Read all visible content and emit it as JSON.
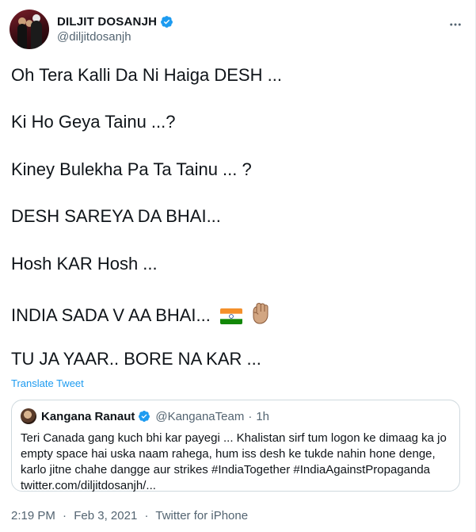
{
  "author": {
    "display_name": "DILJIT DOSANJH",
    "handle": "@diljitdosanjh",
    "verified": true
  },
  "tweet": {
    "lines": [
      "Oh Tera Kalli Da Ni Haiga DESH ...",
      "Ki Ho Geya Tainu ...?",
      "Kiney Bulekha Pa Ta Tainu ... ?",
      "DESH SAREYA DA BHAI...",
      "Hosh KAR Hosh ...",
      "INDIA SADA V AA BHAI...",
      "TU JA YAAR.. BORE NA KAR ..."
    ],
    "emoji": [
      "india-flag",
      "raised-fist-medium-skin"
    ],
    "translate_label": "Translate Tweet"
  },
  "quoted_tweet": {
    "display_name": "Kangana Ranaut",
    "handle": "@KanganaTeam",
    "separator": "·",
    "time": "1h",
    "verified": true,
    "text": "Teri Canada gang kuch bhi kar payegi ... Khalistan sirf tum logon ke dimaag ka jo empty space hai uska naam rahega, hum iss desh ke tukde nahin hone denge, karlo jitne chahe dangge aur strikes #IndiaTogether #IndiaAgainstPropaganda twitter.com/diljitdosanjh/..."
  },
  "footer": {
    "time": "2:19 PM",
    "dot1": "·",
    "date": "Feb 3, 2021",
    "dot2": "·",
    "source": "Twitter for iPhone"
  },
  "colors": {
    "link": "#1d9bf0",
    "muted": "#536471",
    "verified": "#1d9bf0",
    "border": "#cfd9de"
  }
}
